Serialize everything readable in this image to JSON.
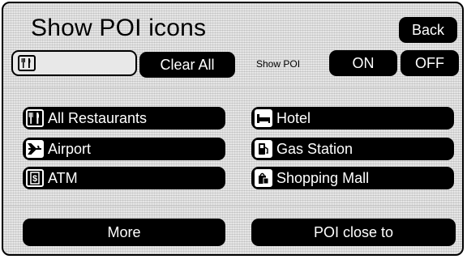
{
  "header": {
    "title": "Show POI icons",
    "back_label": "Back"
  },
  "controls": {
    "clear_all_label": "Clear All",
    "show_poi_label": "Show POI",
    "on_label": "ON",
    "off_label": "OFF",
    "selected_icon": "restaurant-icon"
  },
  "poi_list": [
    {
      "label": "All Restaurants",
      "icon": "restaurant-icon"
    },
    {
      "label": "Hotel",
      "icon": "bed-icon"
    },
    {
      "label": "Airport",
      "icon": "airplane-icon"
    },
    {
      "label": "Gas Station",
      "icon": "fuel-pump-icon"
    },
    {
      "label": "ATM",
      "icon": "dollar-icon"
    },
    {
      "label": "Shopping Mall",
      "icon": "shopping-bag-icon"
    }
  ],
  "footer": {
    "more_label": "More",
    "poi_close_to_label": "POI close to"
  },
  "colors": {
    "button_bg": "#000000",
    "button_text": "#ffffff",
    "screen_bg": "#e6e6e6"
  }
}
